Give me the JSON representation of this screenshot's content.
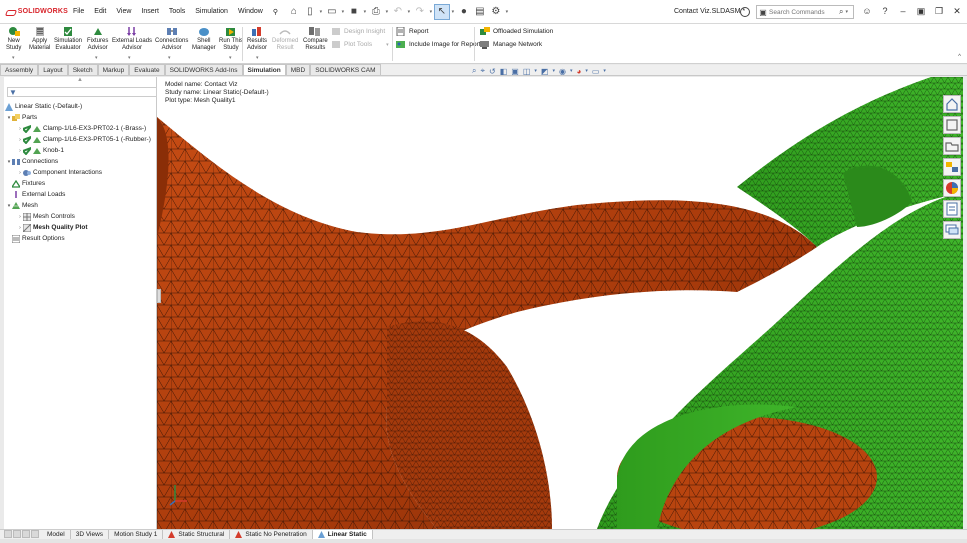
{
  "app": {
    "name": "SOLIDWORKS",
    "document_title": "Contact Viz.SLDASM *"
  },
  "menu": [
    "File",
    "Edit",
    "View",
    "Insert",
    "Tools",
    "Simulation",
    "Window"
  ],
  "search": {
    "placeholder": "Search Commands"
  },
  "ribbon": {
    "big_buttons": [
      {
        "id": "new-study",
        "label1": "New",
        "label2": "Study",
        "icon": "new-study-icon"
      },
      {
        "id": "apply-material",
        "label1": "Apply",
        "label2": "Material",
        "icon": "apply-material-icon"
      },
      {
        "id": "simulation-evaluator",
        "label1": "Simulation",
        "label2": "Evaluator",
        "icon": "simulation-evaluator-icon"
      },
      {
        "id": "fixtures-advisor",
        "label1": "Fixtures",
        "label2": "Advisor",
        "icon": "fixtures-advisor-icon"
      },
      {
        "id": "external-loads-advisor",
        "label1": "External Loads",
        "label2": "Advisor",
        "icon": "external-loads-icon"
      },
      {
        "id": "connections-advisor",
        "label1": "Connections",
        "label2": "Advisor",
        "icon": "connections-advisor-icon"
      },
      {
        "id": "shell-manager",
        "label1": "Shell",
        "label2": "Manager",
        "icon": "shell-manager-icon"
      },
      {
        "id": "run-this-study",
        "label1": "Run This",
        "label2": "Study",
        "icon": "run-study-icon"
      },
      {
        "id": "results-advisor",
        "label1": "Results",
        "label2": "Advisor",
        "icon": "results-advisor-icon"
      },
      {
        "id": "deformed-result",
        "label1": "Deformed",
        "label2": "Result",
        "icon": "deformed-result-icon"
      },
      {
        "id": "compare-results",
        "label1": "Compare",
        "label2": "Results",
        "icon": "compare-results-icon"
      }
    ],
    "design_insight": "Design Insight",
    "plot_tools": "Plot Tools",
    "report": "Report",
    "include_image": "Include Image for Report",
    "offloaded_simulation": "Offloaded Simulation",
    "manage_network": "Manage Network"
  },
  "tabs": [
    "Assembly",
    "Layout",
    "Sketch",
    "Markup",
    "Evaluate",
    "SOLIDWORKS Add-Ins",
    "Simulation",
    "MBD",
    "SOLIDWORKS CAM"
  ],
  "active_tab": "Simulation",
  "tree": {
    "root": "Linear Static (-Default-)",
    "parts_label": "Parts",
    "parts": [
      "Clamp-1/L6-EX3-PRT02-1 (-Brass-)",
      "Clamp-1/L6-EX3-PRT05-1 (-Rubber-)",
      "Knob-1"
    ],
    "connections_label": "Connections",
    "component_interactions": "Component Interactions",
    "fixtures": "Fixtures",
    "external_loads": "External Loads",
    "mesh_label": "Mesh",
    "mesh_controls": "Mesh Controls",
    "mesh_quality_plot": "Mesh Quality Plot",
    "result_options": "Result Options"
  },
  "viewport": {
    "model_name": "Model name: Contact Viz",
    "study_name": "Study name: Linear Static(-Default-)",
    "plot_type": "Plot type: Mesh Quality1",
    "colors": {
      "brass": "#b8440f",
      "rubber": "#2e9e1c",
      "mesh_line": "#1a1a1a"
    }
  },
  "bottom_tabs": [
    "Model",
    "3D Views",
    "Motion Study 1",
    "Static Structural",
    "Static No Penetration",
    "Linear Static"
  ],
  "active_bottom_tab": "Linear Static"
}
